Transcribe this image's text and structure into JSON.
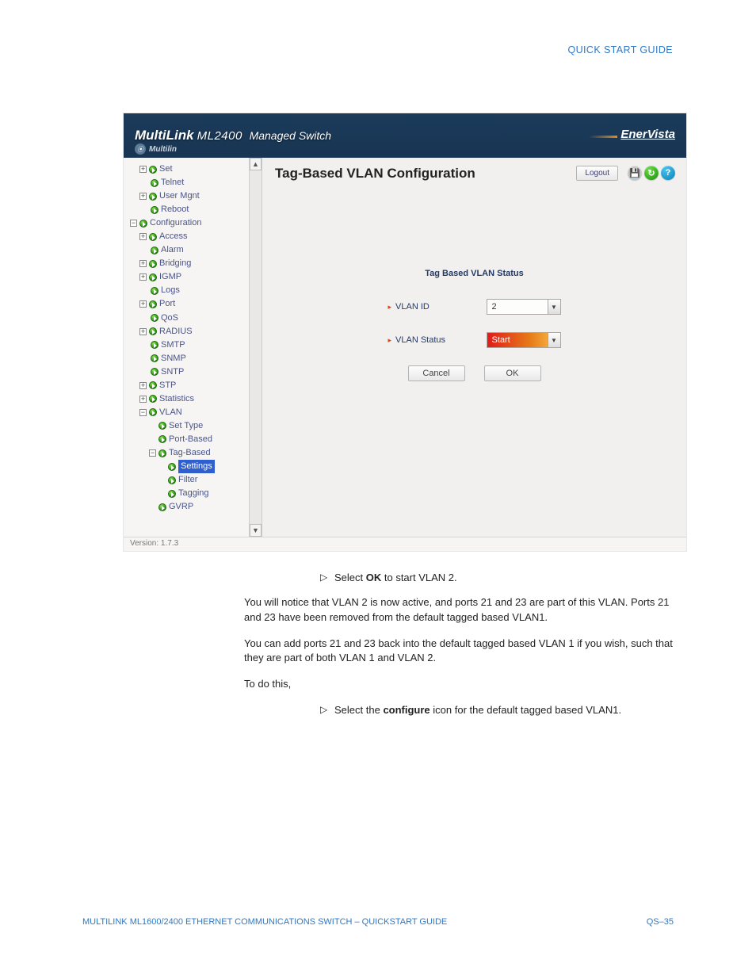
{
  "header": {
    "right": "QUICK START GUIDE"
  },
  "ss": {
    "product_logo_main": "MultiLink",
    "product_logo_model": "ML2400",
    "product_logo_tag": "Managed Switch",
    "brand_sub": "Multilin",
    "brand_right": "EnerVista",
    "title": "Tag-Based VLAN Configuration",
    "logout": "Logout",
    "panel_subtitle": "Tag Based VLAN Status",
    "vlan_id_label": "VLAN ID",
    "vlan_id_value": "2",
    "vlan_status_label": "VLAN Status",
    "vlan_status_value": "Start",
    "btn_cancel": "Cancel",
    "btn_ok": "OK",
    "version": "Version: 1.7.3",
    "tree": {
      "set": "Set",
      "telnet": "Telnet",
      "usermgnt": "User Mgnt",
      "reboot": "Reboot",
      "configuration": "Configuration",
      "access": "Access",
      "alarm": "Alarm",
      "bridging": "Bridging",
      "igmp": "IGMP",
      "logs": "Logs",
      "port": "Port",
      "qos": "QoS",
      "radius": "RADIUS",
      "smtp": "SMTP",
      "snmp": "SNMP",
      "sntp": "SNTP",
      "stp": "STP",
      "statistics": "Statistics",
      "vlan": "VLAN",
      "settype": "Set Type",
      "portbased": "Port-Based",
      "tagbased": "Tag-Based",
      "settings": "Settings",
      "filter": "Filter",
      "tagging": "Tagging",
      "gvrp": "GVRP"
    }
  },
  "doc": {
    "step1_pre": "Select ",
    "step1_bold": "OK",
    "step1_post": " to start VLAN 2.",
    "p1": "You will notice that VLAN 2 is now active, and ports 21 and 23 are part of this VLAN. Ports 21 and 23 have been removed from the default tagged based VLAN1.",
    "p2": "You can add ports 21 and 23 back into the default tagged based VLAN 1 if you wish, such that they are part of both VLAN 1 and VLAN 2.",
    "p3": "To do this,",
    "step2_pre": "Select the ",
    "step2_bold": "configure",
    "step2_post": " icon for the default tagged based VLAN1."
  },
  "footer": {
    "left": "MULTILINK ML1600/2400 ETHERNET COMMUNICATIONS SWITCH – QUICKSTART GUIDE",
    "right": "QS–35"
  }
}
